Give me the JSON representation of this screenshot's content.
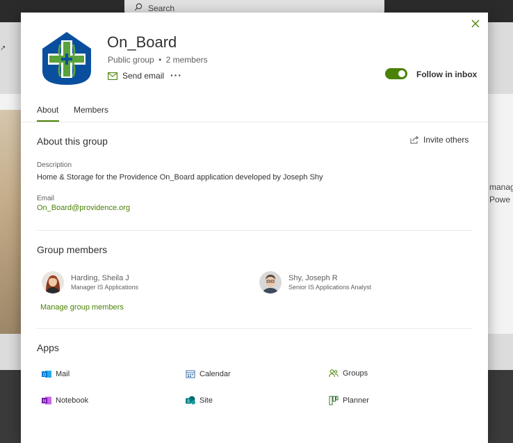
{
  "background": {
    "search_placeholder": "Search",
    "side_text_line1": "manag",
    "side_text_line2": "Powe"
  },
  "group": {
    "name": "On_Board",
    "privacy": "Public group",
    "separator": "•",
    "member_count": "2 members",
    "send_email_label": "Send email",
    "more_label": "···",
    "follow_label": "Follow in inbox",
    "follow_enabled": true
  },
  "tabs": [
    {
      "label": "About",
      "selected": true
    },
    {
      "label": "Members",
      "selected": false
    }
  ],
  "about": {
    "title": "About this group",
    "invite_label": "Invite others",
    "description_label": "Description",
    "description": "Home & Storage for the Providence On_Board application developed by Joseph Shy",
    "email_label": "Email",
    "email": "On_Board@providence.org"
  },
  "members_section": {
    "title": "Group members",
    "members": [
      {
        "name": "Harding, Sheila J",
        "title": "Manager IS Applications"
      },
      {
        "name": "Shy, Joseph R",
        "title": "Senior IS Applications Analyst"
      }
    ],
    "manage_label": "Manage group members"
  },
  "apps_section": {
    "title": "Apps",
    "apps": [
      {
        "label": "Mail",
        "icon": "outlook-mail-icon",
        "color": "#0078d4"
      },
      {
        "label": "Calendar",
        "icon": "calendar-icon",
        "color": "#3a6ea5"
      },
      {
        "label": "Groups",
        "icon": "groups-icon",
        "color": "#498205"
      },
      {
        "label": "Notebook",
        "icon": "onenote-icon",
        "color": "#7719aa"
      },
      {
        "label": "Site",
        "icon": "sharepoint-icon",
        "color": "#038387"
      },
      {
        "label": "Planner",
        "icon": "planner-icon",
        "color": "#31752f"
      }
    ]
  },
  "colors": {
    "accent": "#498205",
    "logo_blue": "#0a4f9e",
    "logo_green": "#5aa23c"
  }
}
